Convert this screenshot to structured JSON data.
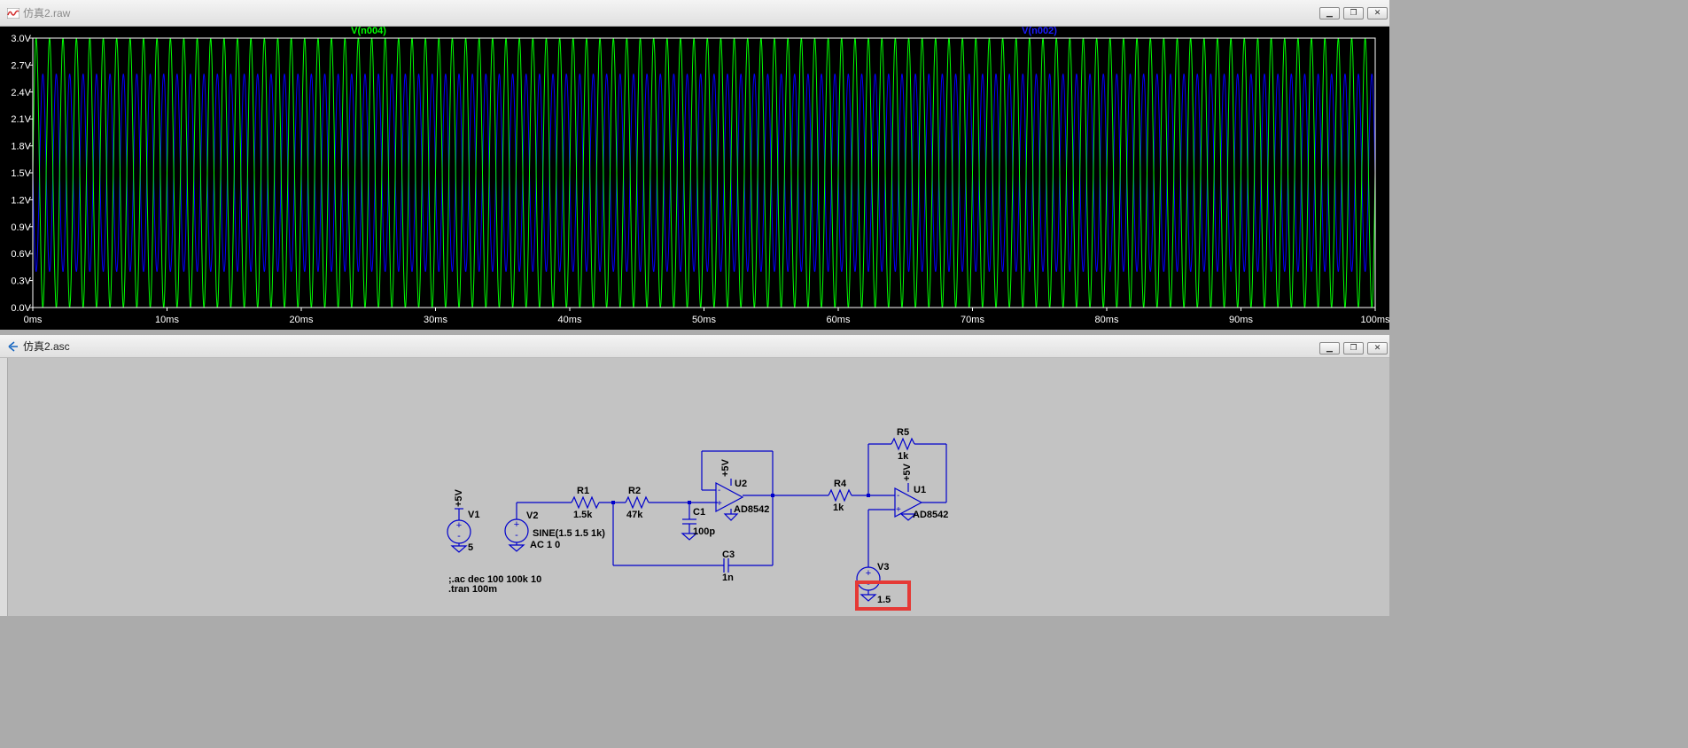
{
  "plot_window": {
    "title": "仿真2.raw",
    "trace_labels": [
      "V(n004)",
      "V(n002)"
    ],
    "trace_colors": {
      "V(n004)": "#00ff00",
      "V(n002)": "#0000ff"
    },
    "icon": "waveform-icon"
  },
  "chart_data": {
    "type": "line",
    "title": "",
    "xlabel": "",
    "ylabel": "",
    "x_ticks": [
      "0ms",
      "10ms",
      "20ms",
      "30ms",
      "40ms",
      "50ms",
      "60ms",
      "70ms",
      "80ms",
      "90ms",
      "100ms"
    ],
    "y_ticks": [
      "0.0V",
      "0.3V",
      "0.6V",
      "0.9V",
      "1.2V",
      "1.5V",
      "1.8V",
      "2.1V",
      "2.4V",
      "2.7V",
      "3.0V"
    ],
    "xlim": [
      0,
      100
    ],
    "ylim": [
      0,
      3
    ],
    "grid": false,
    "series": [
      {
        "name": "V(n004)",
        "color": "#00ff00",
        "frequency_khz": 1,
        "offset_v": 1.5,
        "amplitude_v": 1.5,
        "x_unit": "ms"
      },
      {
        "name": "V(n002)",
        "color": "#0000ff",
        "frequency_khz": 1,
        "offset_v": 1.5,
        "amplitude_v": 1.1,
        "x_unit": "ms"
      }
    ]
  },
  "schematic_window": {
    "title": "仿真2.asc",
    "icon": "schematic-icon",
    "labels": {
      "v1_supply": "+5V",
      "v1_name": "V1",
      "v1_value": "5",
      "v2_name": "V2",
      "v2_value": "SINE(1.5 1.5 1k)",
      "v2_ac": "AC 1 0",
      "r1_name": "R1",
      "r1_value": "1.5k",
      "r2_name": "R2",
      "r2_value": "47k",
      "c1_name": "C1",
      "c1_value": "100p",
      "c3_name": "C3",
      "c3_value": "1n",
      "u2_supply": "+5V",
      "u2_name": "U2",
      "u2_model": "AD8542",
      "r4_name": "R4",
      "r4_value": "1k",
      "r5_name": "R5",
      "r5_value": "1k",
      "u1_supply": "+5V",
      "u1_name": "U1",
      "u1_model": "AD8542",
      "v3_name": "V3",
      "v3_value": "1.5",
      "directive_ac": ";.ac dec 100 100k 10",
      "directive_tran": ".tran 100m",
      "minus": "-",
      "plus": "+"
    },
    "highlight_color": "#e53935",
    "wire_color": "#0000cc"
  }
}
